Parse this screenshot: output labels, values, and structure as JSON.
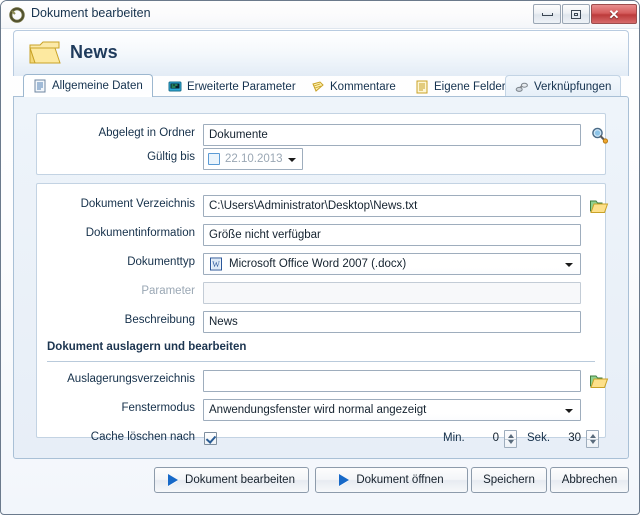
{
  "window": {
    "title": "Dokument bearbeiten",
    "icon": "app-ring-icon",
    "buttons": {
      "minimize": "minimize-icon",
      "maximize": "maximize-icon",
      "close": "✕"
    }
  },
  "header": {
    "title": "News",
    "icon": "folder-icon"
  },
  "tabs": [
    {
      "label": "Allgemeine Daten",
      "icon": "document-lines-icon",
      "state": "active"
    },
    {
      "label": "Erweiterte Parameter",
      "icon": "monitor-icon",
      "state": "normal"
    },
    {
      "label": "Kommentare",
      "icon": "notes-icon",
      "state": "plain"
    },
    {
      "label": "Eigene Felder",
      "icon": "fields-icon",
      "state": "plain"
    },
    {
      "label": "Verknüpfungen",
      "icon": "link-icon",
      "state": "hover"
    }
  ],
  "group_top": {
    "folder": {
      "label": "Abgelegt in Ordner",
      "value": "Dokumente",
      "browse_icon": "search-folder-icon"
    },
    "valid_until": {
      "label": "Gültig bis",
      "value": "22.10.2013",
      "checked": false,
      "dropdown_icon": "chevron-down-icon"
    }
  },
  "group_main": {
    "directory": {
      "label": "Dokument Verzeichnis",
      "value": "C:\\Users\\Administrator\\Desktop\\News.txt",
      "browse_icon": "open-folder-icon"
    },
    "info": {
      "label": "Dokumentinformation",
      "value": "Größe nicht verfügbar"
    },
    "doctype": {
      "label": "Dokumenttyp",
      "value": "Microsoft Office Word 2007 (.docx)",
      "icon": "word-icon"
    },
    "parameter": {
      "label": "Parameter",
      "value": "",
      "disabled": true
    },
    "description": {
      "label": "Beschreibung",
      "value": "News"
    },
    "section_title": "Dokument auslagern und bearbeiten",
    "checkout_dir": {
      "label": "Auslagerungsverzeichnis",
      "value": "",
      "browse_icon": "open-folder-icon"
    },
    "window_mode": {
      "label": "Fenstermodus",
      "value": "Anwendungsfenster wird normal angezeigt"
    },
    "cache": {
      "label": "Cache löschen nach",
      "checked": true,
      "min_label": "Min.",
      "min_value": "0",
      "sec_label": "Sek.",
      "sec_value": "30"
    }
  },
  "footer": {
    "edit_document": "Dokument bearbeiten",
    "open_document": "Dokument öffnen",
    "save": "Speichern",
    "cancel": "Abbrechen"
  },
  "colors": {
    "accent": "#1769c8",
    "title_text": "#16324d",
    "panel_border": "#a9c0d6"
  }
}
